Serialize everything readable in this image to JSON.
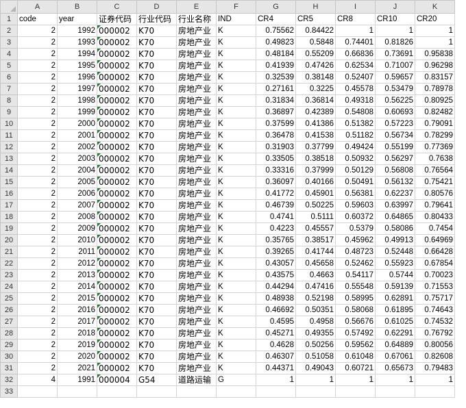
{
  "sheet": {
    "column_letters": [
      "A",
      "B",
      "C",
      "D",
      "E",
      "F",
      "G",
      "H",
      "I",
      "J",
      "K"
    ],
    "rows": [
      [
        "code",
        "year",
        "证券代码",
        "行业代码",
        "行业名称",
        "IND",
        "CR4",
        "CR5",
        "CR8",
        "CR10",
        "CR20"
      ],
      [
        "2",
        "1992",
        "000002",
        "K70",
        "房地产业",
        "K",
        "0.75562",
        "0.84422",
        "1",
        "1",
        "1"
      ],
      [
        "2",
        "1993",
        "000002",
        "K70",
        "房地产业",
        "K",
        "0.49823",
        "0.5848",
        "0.74401",
        "0.81826",
        "1"
      ],
      [
        "2",
        "1994",
        "000002",
        "K70",
        "房地产业",
        "K",
        "0.48184",
        "0.55209",
        "0.66836",
        "0.73691",
        "0.95838"
      ],
      [
        "2",
        "1995",
        "000002",
        "K70",
        "房地产业",
        "K",
        "0.41939",
        "0.47426",
        "0.62534",
        "0.71007",
        "0.96298"
      ],
      [
        "2",
        "1996",
        "000002",
        "K70",
        "房地产业",
        "K",
        "0.32539",
        "0.38148",
        "0.52407",
        "0.59657",
        "0.83157"
      ],
      [
        "2",
        "1997",
        "000002",
        "K70",
        "房地产业",
        "K",
        "0.27161",
        "0.3225",
        "0.45578",
        "0.53479",
        "0.78978"
      ],
      [
        "2",
        "1998",
        "000002",
        "K70",
        "房地产业",
        "K",
        "0.31834",
        "0.36814",
        "0.49318",
        "0.56225",
        "0.80925"
      ],
      [
        "2",
        "1999",
        "000002",
        "K70",
        "房地产业",
        "K",
        "0.36897",
        "0.42389",
        "0.54808",
        "0.60693",
        "0.82482"
      ],
      [
        "2",
        "2000",
        "000002",
        "K70",
        "房地产业",
        "K",
        "0.37599",
        "0.41386",
        "0.51382",
        "0.57223",
        "0.79091"
      ],
      [
        "2",
        "2001",
        "000002",
        "K70",
        "房地产业",
        "K",
        "0.36478",
        "0.41538",
        "0.51182",
        "0.56734",
        "0.78299"
      ],
      [
        "2",
        "2002",
        "000002",
        "K70",
        "房地产业",
        "K",
        "0.31903",
        "0.37799",
        "0.49424",
        "0.55199",
        "0.77369"
      ],
      [
        "2",
        "2003",
        "000002",
        "K70",
        "房地产业",
        "K",
        "0.33505",
        "0.38518",
        "0.50932",
        "0.56297",
        "0.7638"
      ],
      [
        "2",
        "2004",
        "000002",
        "K70",
        "房地产业",
        "K",
        "0.33316",
        "0.37999",
        "0.50129",
        "0.56808",
        "0.76564"
      ],
      [
        "2",
        "2005",
        "000002",
        "K70",
        "房地产业",
        "K",
        "0.36097",
        "0.40166",
        "0.50491",
        "0.56132",
        "0.75421"
      ],
      [
        "2",
        "2006",
        "000002",
        "K70",
        "房地产业",
        "K",
        "0.41772",
        "0.45901",
        "0.56381",
        "0.62237",
        "0.80576"
      ],
      [
        "2",
        "2007",
        "000002",
        "K70",
        "房地产业",
        "K",
        "0.46739",
        "0.50225",
        "0.59603",
        "0.63997",
        "0.79641"
      ],
      [
        "2",
        "2008",
        "000002",
        "K70",
        "房地产业",
        "K",
        "0.4741",
        "0.5111",
        "0.60372",
        "0.64865",
        "0.80433"
      ],
      [
        "2",
        "2009",
        "000002",
        "K70",
        "房地产业",
        "K",
        "0.4223",
        "0.45557",
        "0.5379",
        "0.58086",
        "0.7454"
      ],
      [
        "2",
        "2010",
        "000002",
        "K70",
        "房地产业",
        "K",
        "0.35765",
        "0.38517",
        "0.45962",
        "0.49913",
        "0.64969"
      ],
      [
        "2",
        "2011",
        "000002",
        "K70",
        "房地产业",
        "K",
        "0.39265",
        "0.41744",
        "0.48723",
        "0.52448",
        "0.66428"
      ],
      [
        "2",
        "2012",
        "000002",
        "K70",
        "房地产业",
        "K",
        "0.43057",
        "0.45658",
        "0.52462",
        "0.55923",
        "0.67854"
      ],
      [
        "2",
        "2013",
        "000002",
        "K70",
        "房地产业",
        "K",
        "0.43575",
        "0.4663",
        "0.54117",
        "0.5744",
        "0.70023"
      ],
      [
        "2",
        "2014",
        "000002",
        "K70",
        "房地产业",
        "K",
        "0.44294",
        "0.47416",
        "0.55548",
        "0.59139",
        "0.71553"
      ],
      [
        "2",
        "2015",
        "000002",
        "K70",
        "房地产业",
        "K",
        "0.48938",
        "0.52198",
        "0.58995",
        "0.62891",
        "0.75717"
      ],
      [
        "2",
        "2016",
        "000002",
        "K70",
        "房地产业",
        "K",
        "0.46692",
        "0.50351",
        "0.58068",
        "0.61895",
        "0.74643"
      ],
      [
        "2",
        "2017",
        "000002",
        "K70",
        "房地产业",
        "K",
        "0.4595",
        "0.4958",
        "0.56676",
        "0.61025",
        "0.74532"
      ],
      [
        "2",
        "2018",
        "000002",
        "K70",
        "房地产业",
        "K",
        "0.45271",
        "0.49355",
        "0.57492",
        "0.62291",
        "0.76792"
      ],
      [
        "2",
        "2019",
        "000002",
        "K70",
        "房地产业",
        "K",
        "0.4628",
        "0.50256",
        "0.59562",
        "0.64889",
        "0.80056"
      ],
      [
        "2",
        "2020",
        "000002",
        "K70",
        "房地产业",
        "K",
        "0.46307",
        "0.51058",
        "0.61048",
        "0.67061",
        "0.82608"
      ],
      [
        "2",
        "2021",
        "000002",
        "K70",
        "房地产业",
        "K",
        "0.44371",
        "0.49043",
        "0.60721",
        "0.65673",
        "0.79483"
      ],
      [
        "4",
        "1991",
        "000004",
        "G54",
        "道路运输",
        "G",
        "1",
        "1",
        "1",
        "1",
        "1"
      ],
      [
        "",
        "",
        "",
        "",
        "",
        "",
        "",
        "",
        "",
        "",
        ""
      ]
    ]
  }
}
